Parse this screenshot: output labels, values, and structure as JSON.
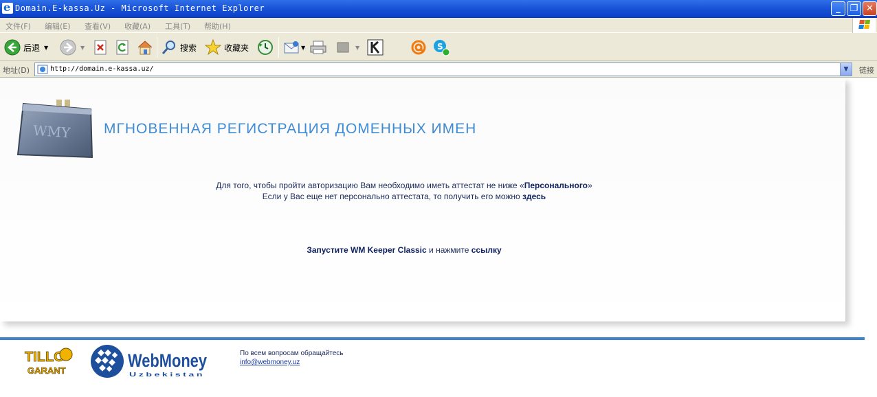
{
  "window": {
    "title": "Domain.E-kassa.Uz - Microsoft Internet Explorer",
    "minimize": "_",
    "restore": "❐",
    "close": "✕"
  },
  "menu": {
    "items": [
      "文件(F)",
      "编辑(E)",
      "查看(V)",
      "收藏(A)",
      "工具(T)",
      "帮助(H)"
    ]
  },
  "toolbar": {
    "back_label": "后退",
    "search_label": "搜索",
    "favorites_label": "收藏夹"
  },
  "address": {
    "label": "地址(D)",
    "url": "http://domain.e-kassa.uz/",
    "links_label": "链接"
  },
  "page": {
    "wallet_text": "WMY",
    "heading": "МГНОВЕННАЯ РЕГИСТРАЦИЯ ДОМЕННЫХ ИМЕН",
    "notice_line1_pre": "Для того, чтобы пройти авторизацию Вам необходимо иметь аттестат не ниже «",
    "notice_line1_bold": "Персонального",
    "notice_line1_post": "»",
    "notice_line2_pre": "Если у Вас еще нет персонально аттестата, то получить его можно ",
    "notice_line2_link": "здесь",
    "launch_pre": "Запустите WM Keeper Classic",
    "launch_mid": " и нажмите ",
    "launch_link": "ссылку"
  },
  "footer": {
    "tilo_top": "TILLO",
    "tilo_bottom": "GARANT",
    "wm_name": "WebMoney",
    "wm_sub": "Uzbekistan",
    "contact_text": "По всем вопросам обращайтесь",
    "contact_email": "info@webmoney.uz"
  },
  "colors": {
    "heading": "#3f8bd4",
    "footer_line": "#3d84cc",
    "wm_blue": "#1e4f9c"
  }
}
